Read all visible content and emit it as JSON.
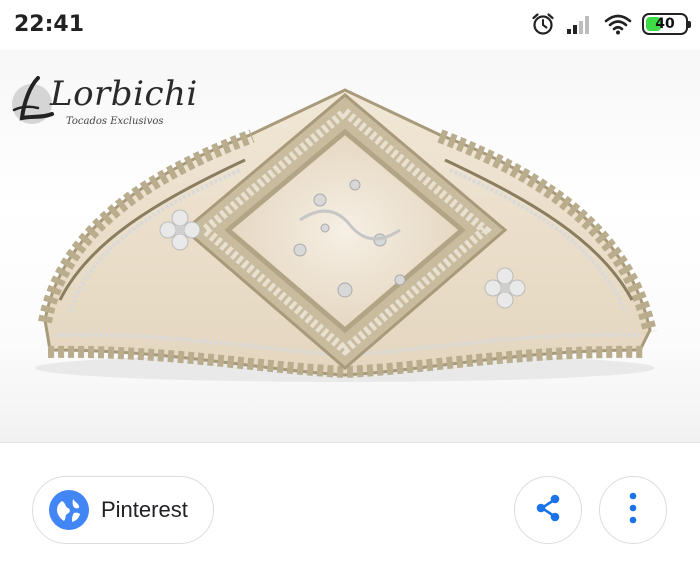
{
  "status_bar": {
    "time": "22:41",
    "battery_level": "40",
    "battery_fraction": 0.4,
    "battery_color": "#3ddc47",
    "icons": [
      "alarm-icon",
      "signal-icon",
      "wifi-icon",
      "battery-icon"
    ]
  },
  "image": {
    "logo_text": "Lorbichi",
    "logo_tagline": "Tocados Exclusivos"
  },
  "actions": {
    "source_label": "Pinterest",
    "source_icon": "globe-icon",
    "share_icon": "share-icon",
    "more_icon": "more-vert-icon",
    "accent_color": "#4285f4"
  }
}
